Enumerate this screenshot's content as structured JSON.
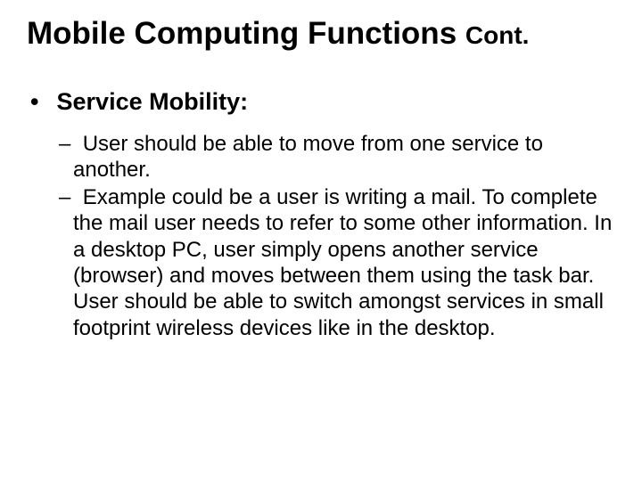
{
  "title": {
    "main": "Mobile Computing Functions ",
    "cont": "Cont."
  },
  "heading": "Service Mobility:",
  "points": [
    "User should be able to move from one service to another.",
    "Example could be a user is writing a mail. To complete the mail user needs to refer to some other information. In a desktop PC, user simply opens another service (browser) and moves between them using the task bar. User should be able to switch amongst services in small footprint wireless devices like in the desktop."
  ]
}
